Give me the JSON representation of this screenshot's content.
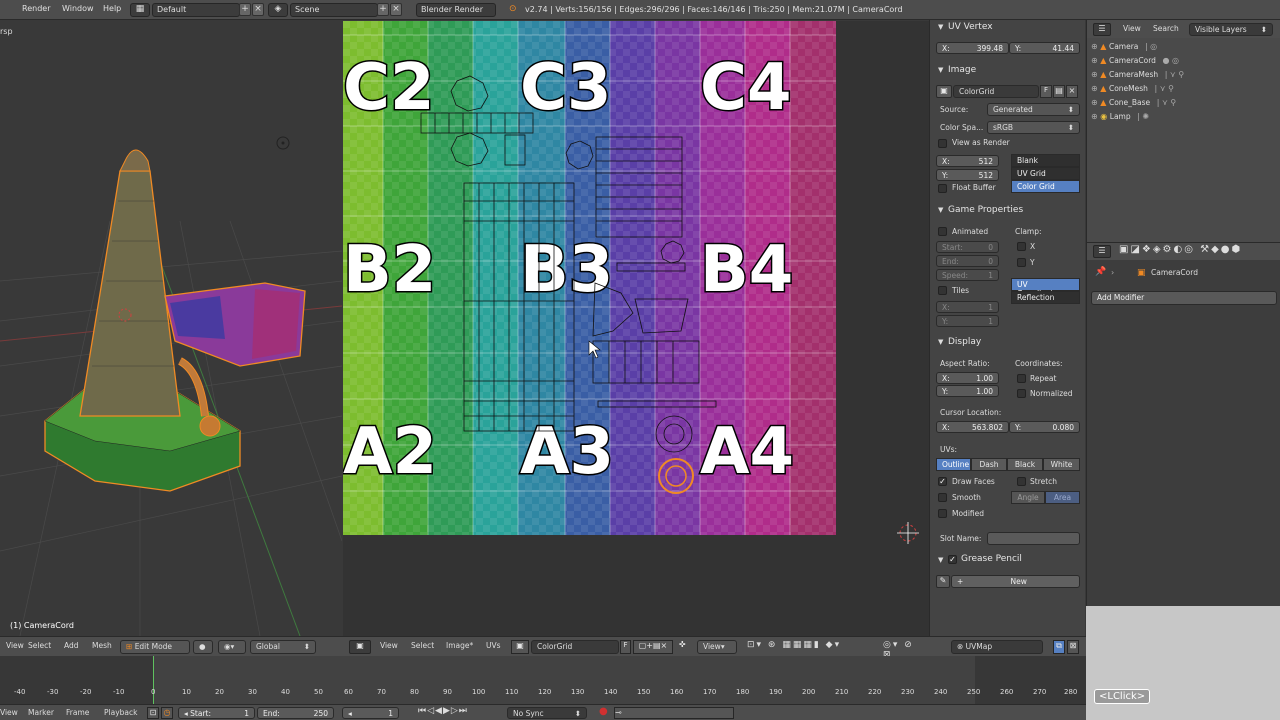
{
  "topbar": {
    "menus": [
      "Render",
      "Window",
      "Help"
    ],
    "screen_layout": "Default",
    "scene": "Scene",
    "render_engine": "Blender Render",
    "stats": "v2.74 | Verts:156/156 | Edges:296/296 | Faces:146/146 | Tris:250 | Mem:21.07M | CameraCord"
  },
  "viewport3d": {
    "view_name_partial": "rsp",
    "object_label": "(1) CameraCord",
    "header": {
      "menus": [
        "View",
        "Select",
        "Add",
        "Mesh"
      ],
      "mode": "Edit Mode",
      "orientation": "Global"
    }
  },
  "uv_editor": {
    "grid_labels": {
      "row_c": [
        "C2",
        "C3",
        "C4"
      ],
      "row_b": [
        "B2",
        "B3",
        "B4"
      ],
      "row_a": [
        "A2",
        "A3",
        "A4"
      ]
    },
    "header": {
      "menus": [
        "View",
        "Select",
        "Image*",
        "UVs"
      ],
      "image_name": "ColorGrid",
      "fake_user": "F",
      "view_menu": "View",
      "uvmap": "UVMap"
    }
  },
  "npanel": {
    "uv_vertex": {
      "title": "UV Vertex",
      "x_label": "X:",
      "x_value": "399.48",
      "y_label": "Y:",
      "y_value": "41.44"
    },
    "image": {
      "title": "Image",
      "name": "ColorGrid",
      "f_label": "F",
      "source_label": "Source:",
      "source_value": "Generated",
      "colorspace_label": "Color Spa...",
      "colorspace_value": "sRGB",
      "view_as_render": "View as Render",
      "width_label": "X:",
      "width_value": "512",
      "height_label": "Y:",
      "height_value": "512",
      "float_buffer": "Float Buffer",
      "gen_types": [
        "Blank",
        "UV Grid",
        "Color Grid"
      ],
      "gen_selected": "Color Grid"
    },
    "game_properties": {
      "title": "Game Properties",
      "animated": "Animated",
      "start_label": "Start:",
      "start_value": "0",
      "end_label": "End:",
      "end_value": "0",
      "speed_label": "Speed:",
      "speed_value": "1",
      "tiles": "Tiles",
      "tiles_x_label": "X:",
      "tiles_x_value": "1",
      "tiles_y_label": "Y:",
      "tiles_y_value": "1",
      "clamp_label": "Clamp:",
      "clamp_x": "X",
      "clamp_y": "Y",
      "mapping": [
        "UV Coordinates",
        "Reflection"
      ],
      "mapping_selected": "UV Coordinates"
    },
    "display": {
      "title": "Display",
      "aspect_label": "Aspect Ratio:",
      "aspect_x_label": "X:",
      "aspect_x": "1.00",
      "aspect_y_label": "Y:",
      "aspect_y": "1.00",
      "coords_label": "Coordinates:",
      "repeat": "Repeat",
      "normalized": "Normalized",
      "cursor_label": "Cursor Location:",
      "cursor_x_label": "X:",
      "cursor_x": "563.802",
      "cursor_y_label": "Y:",
      "cursor_y": "0.080",
      "uvs_label": "UVs:",
      "uv_styles": [
        "Outline",
        "Dash",
        "Black",
        "White"
      ],
      "uv_style_selected": "Outline",
      "draw_faces": "Draw Faces",
      "stretch": "Stretch",
      "smooth": "Smooth",
      "stretch_modes": [
        "Angle",
        "Area"
      ],
      "modified": "Modified",
      "slot_name_label": "Slot Name:"
    },
    "grease_pencil": {
      "title": "Grease Pencil",
      "new_button": "New"
    }
  },
  "outliner": {
    "header": {
      "view": "View",
      "search": "Search",
      "display_mode": "Visible Layers"
    },
    "items": [
      {
        "label": "Camera"
      },
      {
        "label": "CameraCord"
      },
      {
        "label": "CameraMesh"
      },
      {
        "label": "ConeMesh"
      },
      {
        "label": "Cone_Base"
      },
      {
        "label": "Lamp"
      }
    ]
  },
  "properties": {
    "object_name": "CameraCord",
    "add_modifier": "Add Modifier"
  },
  "timeline": {
    "ticks": [
      "-40",
      "-30",
      "-20",
      "-10",
      "0",
      "10",
      "20",
      "30",
      "40",
      "50",
      "60",
      "70",
      "80",
      "90",
      "100",
      "110",
      "120",
      "130",
      "140",
      "150",
      "160",
      "170",
      "180",
      "190",
      "200",
      "210",
      "220",
      "230",
      "240",
      "250",
      "260",
      "270",
      "280"
    ],
    "menus": [
      "View",
      "Marker",
      "Frame",
      "Playback"
    ],
    "start_label": "Start:",
    "start_value": "1",
    "end_label": "End:",
    "end_value": "250",
    "current_frame": "1",
    "sync": "No Sync"
  },
  "overlay": {
    "key_hint": "<LClick>"
  },
  "colors": {
    "selected_blue": "#5680c2",
    "panel_bg": "#444444",
    "header_bg": "#4d4d4d",
    "select_orange": "#f08a24"
  }
}
